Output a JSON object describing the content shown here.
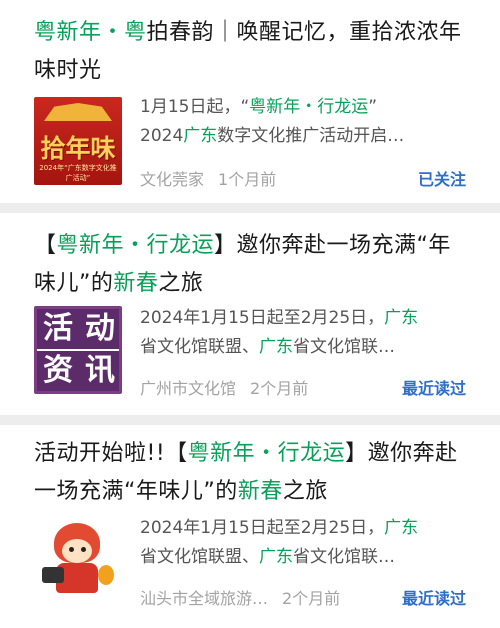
{
  "articles": [
    {
      "title_hl": "粤新年・粤",
      "title_rest": "拍春韵｜唤醒记忆，重拾浓浓年味时光",
      "summary_line1_a": "1月15日起，“",
      "summary_line1_hl": "粤新年・行龙运",
      "summary_line1_b": "”",
      "summary_line2_a": "2024",
      "summary_line2_hl": "广东",
      "summary_line2_b": "数字文化推广活动开启…",
      "source": "文化莞家",
      "time": "1个月前",
      "status": "已关注",
      "thumb_big": "拾年味",
      "thumb_small": "2024年“广东数字文化推广活动”"
    },
    {
      "title_pre": "【",
      "title_hl": "粤新年・行龙运",
      "title_mid": "】邀你奔赴一场充满“年味儿”的",
      "title_hl2": "新春",
      "title_end": "之旅",
      "summary_line1_a": "2024年1月15日起至2月25日，",
      "summary_line1_hl": "广东",
      "summary_line2_a": "省文化馆联盟、",
      "summary_line2_hl": "广东",
      "summary_line2_b": "省文化馆联…",
      "source": "广州市文化馆",
      "time": "2个月前",
      "status": "最近读过",
      "thumb_chars": [
        "活",
        "动",
        "资",
        "讯"
      ]
    },
    {
      "title_pre": "活动开始啦!!【",
      "title_hl": "粤新年・行龙运",
      "title_mid": "】邀你奔赴一场充满“年味儿”的",
      "title_hl2": "新春",
      "title_end": "之旅",
      "summary_line1_a": "2024年1月15日起至2月25日，",
      "summary_line1_hl": "广东",
      "summary_line2_a": "省文化馆联盟、",
      "summary_line2_hl": "广东",
      "summary_line2_b": "省文化馆联…",
      "source": "汕头市全域旅游…",
      "time": "2个月前",
      "status": "最近读过"
    }
  ],
  "colors": {
    "highlight": "#07a15a",
    "status": "#2f6fc9"
  }
}
